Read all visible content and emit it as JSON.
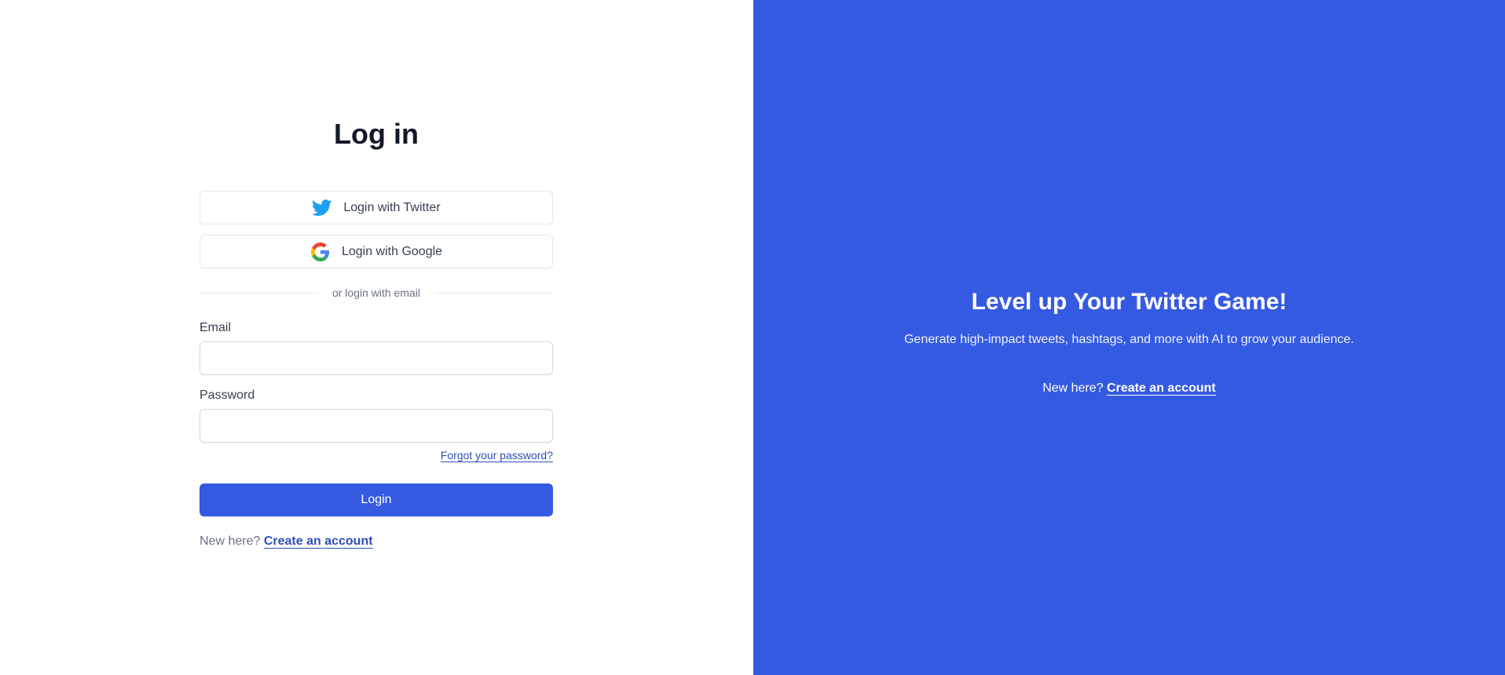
{
  "login": {
    "title": "Log in",
    "twitter_label": "Login with Twitter",
    "google_label": "Login with Google",
    "divider_text": "or login with email",
    "email_label": "Email",
    "email_value": "",
    "password_label": "Password",
    "password_value": "",
    "forgot_label": "Forgot your password?",
    "submit_label": "Login",
    "signup_prompt": "New here?",
    "signup_link": "Create an account"
  },
  "promo": {
    "title": "Level up Your Twitter Game!",
    "subtitle": "Generate high-impact tweets, hashtags, and more with AI to grow your audience.",
    "signup_prompt": "New here?",
    "signup_link": "Create an account"
  },
  "icons": {
    "twitter": "twitter-bird-icon",
    "google": "google-g-icon"
  },
  "colors": {
    "accent": "#355ae2",
    "link": "#2f4fb8",
    "twitter": "#1da1f2"
  }
}
